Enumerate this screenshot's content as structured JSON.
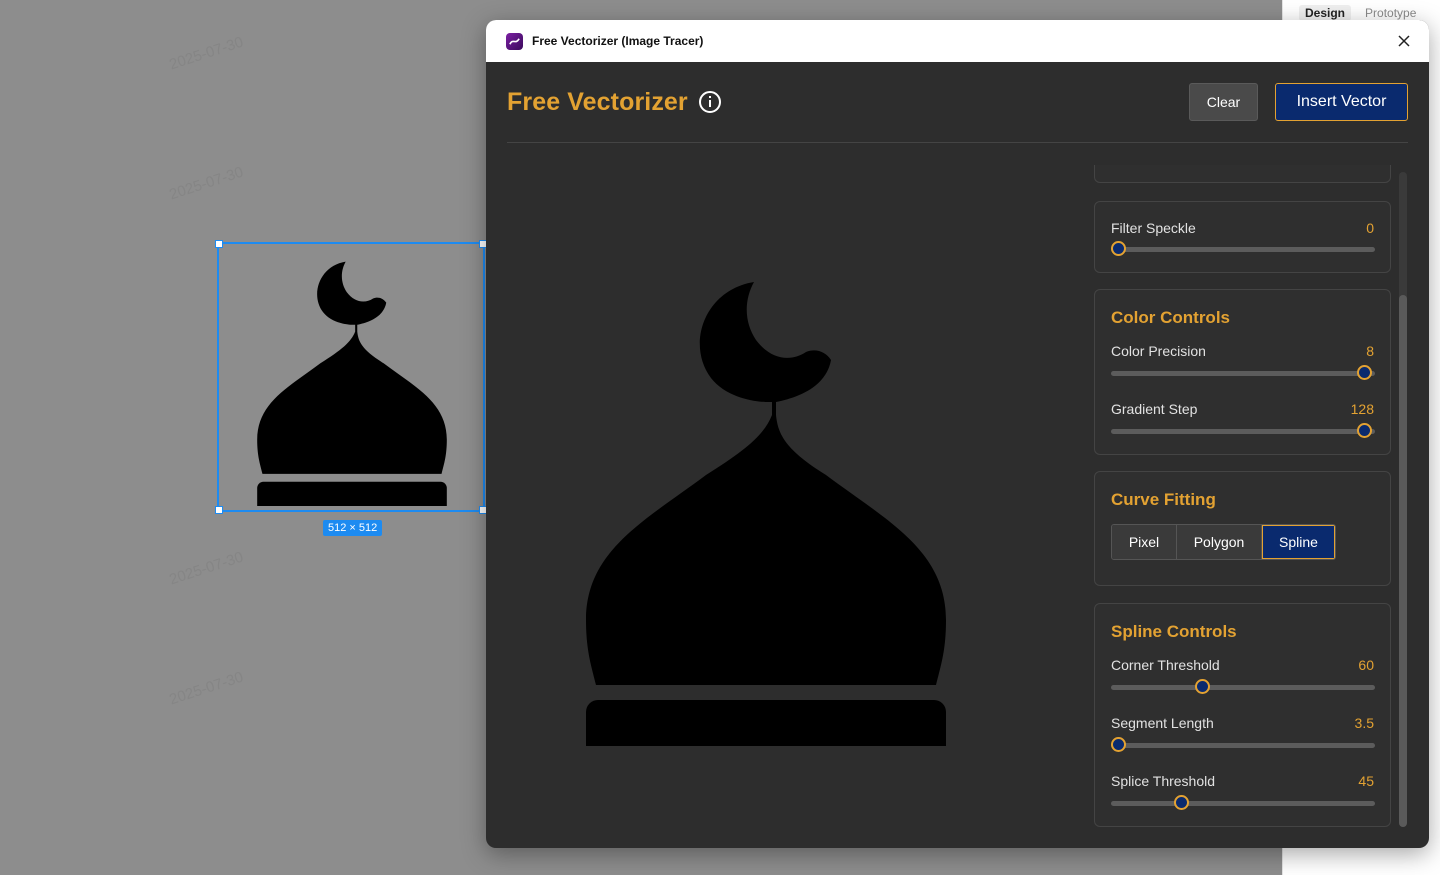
{
  "canvas": {
    "watermark_texts": [
      "2025-07-30",
      "2025-07-30",
      "2025-07-30",
      "2025-07-30"
    ],
    "size_badge": "512 × 512"
  },
  "design_panel": {
    "tabs": [
      {
        "label": "Design",
        "active": true
      },
      {
        "label": "Prototype",
        "active": false
      }
    ]
  },
  "modal": {
    "window_title": "Free Vectorizer (Image Tracer)",
    "brand_title": "Free Vectorizer",
    "clear_label": "Clear",
    "insert_label": "Insert Vector",
    "accent_color": "#e3a232",
    "primary_color": "#0a2a6e"
  },
  "controls": {
    "filter_speckle": {
      "label": "Filter Speckle",
      "value": "0",
      "fraction": 0.0
    },
    "color_controls": {
      "title": "Color Controls",
      "color_precision": {
        "label": "Color Precision",
        "value": "8",
        "fraction": 1.0
      },
      "gradient_step": {
        "label": "Gradient Step",
        "value": "128",
        "fraction": 1.0
      }
    },
    "curve_fitting": {
      "title": "Curve Fitting",
      "options": [
        "Pixel",
        "Polygon",
        "Spline"
      ],
      "selected": "Spline"
    },
    "spline_controls": {
      "title": "Spline Controls",
      "corner_threshold": {
        "label": "Corner Threshold",
        "value": "60",
        "fraction": 0.33
      },
      "segment_length": {
        "label": "Segment Length",
        "value": "3.5",
        "fraction": 0.0
      },
      "splice_threshold": {
        "label": "Splice Threshold",
        "value": "45",
        "fraction": 0.25
      }
    }
  },
  "icons": [
    "app-logo-icon",
    "info-icon",
    "close-icon"
  ]
}
